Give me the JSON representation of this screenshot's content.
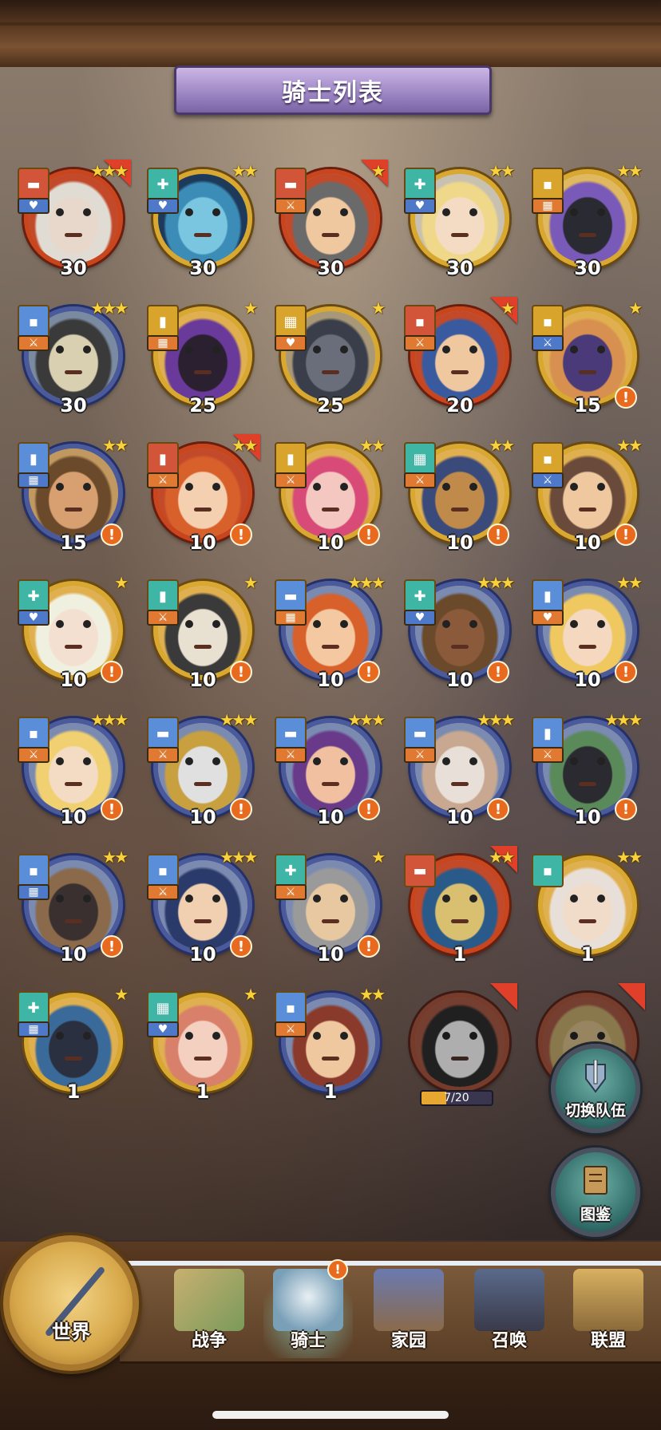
{
  "header": {
    "title": "骑士列表"
  },
  "knights": [
    {
      "level": "30",
      "stars": "★★★",
      "frame": "red",
      "class_color": "red",
      "class_glyph": "▬",
      "role": "♥",
      "role_color": "blue",
      "flag": true,
      "alert": false,
      "skin": "#e8d8cc",
      "hair": "#e0dcd4",
      "bg": "#c24a2a"
    },
    {
      "level": "30",
      "stars": "★★",
      "frame": "gold",
      "class_color": "teal",
      "class_glyph": "✚",
      "role": "♥",
      "role_color": "blue",
      "flag": false,
      "alert": false,
      "skin": "#7ac6e0",
      "hair": "#3c8cb8",
      "bg": "#1e3a5a"
    },
    {
      "level": "30",
      "stars": "★",
      "frame": "red",
      "class_color": "red",
      "class_glyph": "▬",
      "role": "⚔",
      "role_color": "orange",
      "flag": true,
      "alert": false,
      "skin": "#f0c8a0",
      "hair": "#6a6a6a",
      "bg": "#c24a2a"
    },
    {
      "level": "30",
      "stars": "★★",
      "frame": "gold",
      "class_color": "teal",
      "class_glyph": "✚",
      "role": "♥",
      "role_color": "blue",
      "flag": false,
      "alert": false,
      "skin": "#f4dcc4",
      "hair": "#f0d88a",
      "bg": "#c8c0b0"
    },
    {
      "level": "30",
      "stars": "★★",
      "frame": "gold",
      "class_color": "gold",
      "class_glyph": "▪",
      "role": "▦",
      "role_color": "orange",
      "flag": false,
      "alert": false,
      "skin": "#2a2a32",
      "hair": "#7a5ab8",
      "bg": "#e0b860"
    },
    {
      "level": "30",
      "stars": "★★★",
      "frame": "blue",
      "class_color": "blue",
      "class_glyph": "▪",
      "role": "⚔",
      "role_color": "orange",
      "flag": false,
      "alert": false,
      "skin": "#d8d0b0",
      "hair": "#3a3a3a",
      "bg": "#7a8aa0"
    },
    {
      "level": "25",
      "stars": "★",
      "frame": "gold",
      "class_color": "gold",
      "class_glyph": "▮",
      "role": "▦",
      "role_color": "orange",
      "flag": false,
      "alert": false,
      "skin": "#2a2030",
      "hair": "#6a3a9a",
      "bg": "#e0b050"
    },
    {
      "level": "25",
      "stars": "★",
      "frame": "gold",
      "class_color": "gold",
      "class_glyph": "▦",
      "role": "♥",
      "role_color": "orange",
      "flag": false,
      "alert": false,
      "skin": "#6a6e7a",
      "hair": "#3a3e4a",
      "bg": "#a89878"
    },
    {
      "level": "20",
      "stars": "★",
      "frame": "red",
      "class_color": "red",
      "class_glyph": "▪",
      "role": "⚔",
      "role_color": "orange",
      "flag": true,
      "alert": false,
      "skin": "#f0c8a0",
      "hair": "#3a5aa0",
      "bg": "#c24a2a"
    },
    {
      "level": "15",
      "stars": "★",
      "frame": "gold",
      "class_color": "gold",
      "class_glyph": "▪",
      "role": "⚔",
      "role_color": "blue",
      "flag": false,
      "alert": true,
      "skin": "#4a3a7a",
      "hair": "#d89050",
      "bg": "#e0b050"
    },
    {
      "level": "15",
      "stars": "★★",
      "frame": "blue",
      "class_color": "blue",
      "class_glyph": "▮",
      "role": "▦",
      "role_color": "blue",
      "flag": false,
      "alert": true,
      "skin": "#d8a070",
      "hair": "#6a4a2a",
      "bg": "#c09860"
    },
    {
      "level": "10",
      "stars": "★★",
      "frame": "red",
      "class_color": "red",
      "class_glyph": "▮",
      "role": "⚔",
      "role_color": "orange",
      "flag": true,
      "alert": true,
      "skin": "#f4d0b0",
      "hair": "#d8602a",
      "bg": "#c24a2a"
    },
    {
      "level": "10",
      "stars": "★★",
      "frame": "gold",
      "class_color": "gold",
      "class_glyph": "▮",
      "role": "⚔",
      "role_color": "orange",
      "flag": false,
      "alert": true,
      "skin": "#f4c8c0",
      "hair": "#d84a78",
      "bg": "#e0b050"
    },
    {
      "level": "10",
      "stars": "★★",
      "frame": "gold",
      "class_color": "teal",
      "class_glyph": "▦",
      "role": "⚔",
      "role_color": "orange",
      "flag": false,
      "alert": true,
      "skin": "#c08a4a",
      "hair": "#3a4a7a",
      "bg": "#e0b050"
    },
    {
      "level": "10",
      "stars": "★★",
      "frame": "gold",
      "class_color": "gold",
      "class_glyph": "▪",
      "role": "⚔",
      "role_color": "blue",
      "flag": false,
      "alert": true,
      "skin": "#f0c8a0",
      "hair": "#6a4a3a",
      "bg": "#e0b050"
    },
    {
      "level": "10",
      "stars": "★",
      "frame": "gold",
      "class_color": "teal",
      "class_glyph": "✚",
      "role": "♥",
      "role_color": "blue",
      "flag": false,
      "alert": true,
      "skin": "#f4e0d0",
      "hair": "#f0f0e0",
      "bg": "#e0b050"
    },
    {
      "level": "10",
      "stars": "★",
      "frame": "gold",
      "class_color": "teal",
      "class_glyph": "▮",
      "role": "⚔",
      "role_color": "orange",
      "flag": false,
      "alert": true,
      "skin": "#e8e0d0",
      "hair": "#3a3a3a",
      "bg": "#e0b050"
    },
    {
      "level": "10",
      "stars": "★★★",
      "frame": "blue",
      "class_color": "blue",
      "class_glyph": "▬",
      "role": "▦",
      "role_color": "orange",
      "flag": false,
      "alert": true,
      "skin": "#f4c8a0",
      "hair": "#d8602a",
      "bg": "#7a8ab0"
    },
    {
      "level": "10",
      "stars": "★★★",
      "frame": "blue",
      "class_color": "teal",
      "class_glyph": "✚",
      "role": "♥",
      "role_color": "blue",
      "flag": false,
      "alert": true,
      "skin": "#8a5a3a",
      "hair": "#6a4a2a",
      "bg": "#7a8ab0"
    },
    {
      "level": "10",
      "stars": "★★",
      "frame": "blue",
      "class_color": "blue",
      "class_glyph": "▮",
      "role": "♥",
      "role_color": "orange",
      "flag": false,
      "alert": true,
      "skin": "#f4d8c0",
      "hair": "#f0c860",
      "bg": "#7a8ab0"
    },
    {
      "level": "10",
      "stars": "★★★",
      "frame": "blue",
      "class_color": "blue",
      "class_glyph": "▪",
      "role": "⚔",
      "role_color": "orange",
      "flag": false,
      "alert": true,
      "skin": "#f4dcc4",
      "hair": "#f0d070",
      "bg": "#7a8ab0"
    },
    {
      "level": "10",
      "stars": "★★★",
      "frame": "blue",
      "class_color": "blue",
      "class_glyph": "▬",
      "role": "⚔",
      "role_color": "orange",
      "flag": false,
      "alert": true,
      "skin": "#e0e0e0",
      "hair": "#c8a040",
      "bg": "#7a8ab0"
    },
    {
      "level": "10",
      "stars": "★★★",
      "frame": "blue",
      "class_color": "blue",
      "class_glyph": "▬",
      "role": "⚔",
      "role_color": "orange",
      "flag": false,
      "alert": true,
      "skin": "#f0c0a0",
      "hair": "#6a3a8a",
      "bg": "#7a8ab0"
    },
    {
      "level": "10",
      "stars": "★★★",
      "frame": "blue",
      "class_color": "blue",
      "class_glyph": "▬",
      "role": "⚔",
      "role_color": "orange",
      "flag": false,
      "alert": true,
      "skin": "#e8e0d8",
      "hair": "#c8a890",
      "bg": "#7a8ab0"
    },
    {
      "level": "10",
      "stars": "★★★",
      "frame": "blue",
      "class_color": "blue",
      "class_glyph": "▮",
      "role": "⚔",
      "role_color": "orange",
      "flag": false,
      "alert": true,
      "skin": "#2a2a30",
      "hair": "#5a8a5a",
      "bg": "#7a8ab0"
    },
    {
      "level": "10",
      "stars": "★★",
      "frame": "blue",
      "class_color": "blue",
      "class_glyph": "▪",
      "role": "▦",
      "role_color": "blue",
      "flag": false,
      "alert": true,
      "skin": "#3a3030",
      "hair": "#8a6a4a",
      "bg": "#7a8ab0"
    },
    {
      "level": "10",
      "stars": "★★★",
      "frame": "blue",
      "class_color": "blue",
      "class_glyph": "▪",
      "role": "⚔",
      "role_color": "orange",
      "flag": false,
      "alert": true,
      "skin": "#f0d0b0",
      "hair": "#2a3a6a",
      "bg": "#7a8ab0"
    },
    {
      "level": "10",
      "stars": "★",
      "frame": "blue",
      "class_color": "teal",
      "class_glyph": "✚",
      "role": "⚔",
      "role_color": "orange",
      "flag": false,
      "alert": true,
      "skin": "#e8c8a0",
      "hair": "#9a9a9a",
      "bg": "#7a8ab0"
    },
    {
      "level": "1",
      "stars": "★★",
      "frame": "red",
      "class_color": "red",
      "class_glyph": "▬",
      "role": "",
      "role_color": "blue",
      "flag": true,
      "alert": false,
      "skin": "#d8c070",
      "hair": "#2a5a8a",
      "bg": "#c24a2a"
    },
    {
      "level": "1",
      "stars": "★★",
      "frame": "gold",
      "class_color": "teal",
      "class_glyph": "▪",
      "role": "",
      "role_color": "blue",
      "flag": false,
      "alert": false,
      "skin": "#f0dcc8",
      "hair": "#e8e0d8",
      "bg": "#e0b050"
    },
    {
      "level": "1",
      "stars": "★",
      "frame": "gold",
      "class_color": "teal",
      "class_glyph": "✚",
      "role": "▦",
      "role_color": "blue",
      "flag": false,
      "alert": false,
      "skin": "#2a3040",
      "hair": "#3a6a9a",
      "bg": "#e0b050"
    },
    {
      "level": "1",
      "stars": "★",
      "frame": "gold",
      "class_color": "teal",
      "class_glyph": "▦",
      "role": "♥",
      "role_color": "blue",
      "flag": false,
      "alert": false,
      "skin": "#f4d0c0",
      "hair": "#d8806a",
      "bg": "#e0b050"
    },
    {
      "level": "1",
      "stars": "★★",
      "frame": "blue",
      "class_color": "blue",
      "class_glyph": "▪",
      "role": "⚔",
      "role_color": "orange",
      "flag": false,
      "alert": false,
      "skin": "#f0c8a0",
      "hair": "#8a3a2a",
      "bg": "#7a8ab0"
    }
  ],
  "locked_knights": [
    {
      "progress_text": "7/20",
      "progress": 0.35,
      "skin": "#e8e8e8",
      "hair": "#2a2a2a",
      "bg": "#c24a2a"
    },
    {
      "progress_text": "",
      "progress": 0,
      "skin": "#d8b060",
      "hair": "#c8a040",
      "bg": "#c24a2a"
    }
  ],
  "side_buttons": {
    "switch_team": "切换队伍",
    "codex": "图鉴"
  },
  "nav": {
    "world": "世界",
    "war": "战争",
    "knight": "骑士",
    "home": "家园",
    "summon": "召唤",
    "alliance": "联盟"
  },
  "colors": {
    "gold_frame": "#d9a830",
    "red_frame": "#c8451e",
    "blue_frame": "#4a5a9a",
    "alert": "#e86a1e",
    "star": "#f7d23e",
    "banner": "#9b84c2"
  }
}
